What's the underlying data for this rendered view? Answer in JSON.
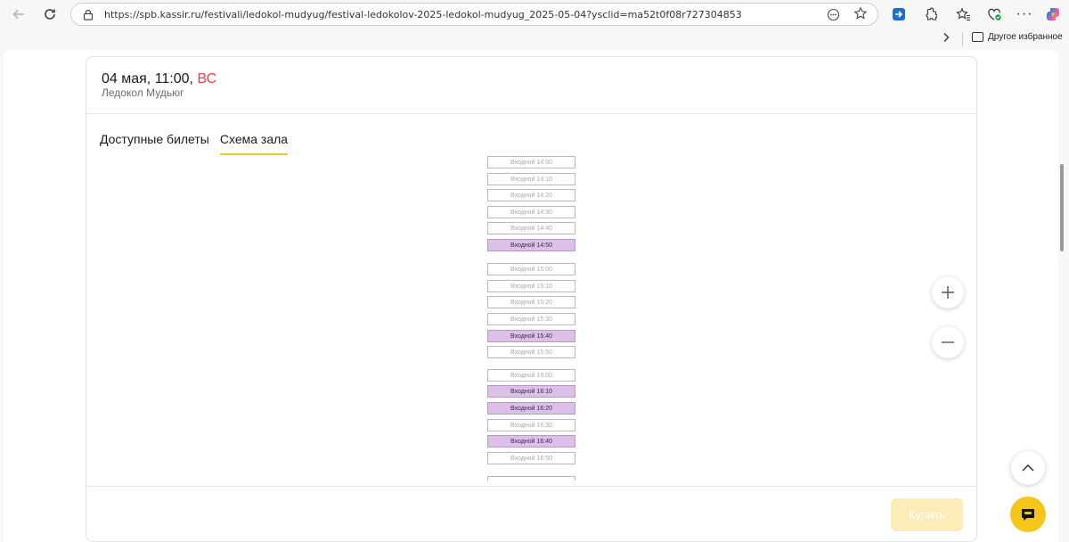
{
  "browser": {
    "url": "https://spb.kassir.ru/festivali/ledokol-mudyug/festival-ledokolov-2025-ledokol-mudyug_2025-05-04?ysclid=ma52t0f08r727304853",
    "favorites_folder": "Другое избранное"
  },
  "event": {
    "date": "04 мая, 11:00,",
    "day": "ВС",
    "venue": "Ледокол Мудьюг"
  },
  "tabs": [
    {
      "label": "Доступные билеты",
      "active": false
    },
    {
      "label": "Схема зала",
      "active": true
    }
  ],
  "scheme": {
    "slots": [
      {
        "label": "Входной 14:00",
        "available": false
      },
      {
        "label": "Входной 14:10",
        "available": false
      },
      {
        "label": "Входной 14:20",
        "available": false
      },
      {
        "label": "Входной 14:30",
        "available": false
      },
      {
        "label": "Входной 14:40",
        "available": false
      },
      {
        "label": "Входной 14:50",
        "available": true
      },
      {
        "label": "Входной 15:00",
        "available": false
      },
      {
        "label": "Входной 15:10",
        "available": false
      },
      {
        "label": "Входной 15:20",
        "available": false
      },
      {
        "label": "Входной 15:30",
        "available": false
      },
      {
        "label": "Входной 15:40",
        "available": true
      },
      {
        "label": "Входной 15:50",
        "available": false
      },
      {
        "label": "Входной 16:00",
        "available": false
      },
      {
        "label": "Входной 16:10",
        "available": true
      },
      {
        "label": "Входной 16:20",
        "available": true
      },
      {
        "label": "Входной 16:30",
        "available": false
      },
      {
        "label": "Входной 16:40",
        "available": true
      },
      {
        "label": "Входной 16:50",
        "available": false
      }
    ],
    "available_color": "#dcc0e8"
  },
  "zoom": {
    "in_label": "+",
    "out_label": "−"
  },
  "footer": {
    "buy_label": "Купить"
  },
  "colors": {
    "accent": "#f5c518",
    "weekday": "#e0454f"
  }
}
